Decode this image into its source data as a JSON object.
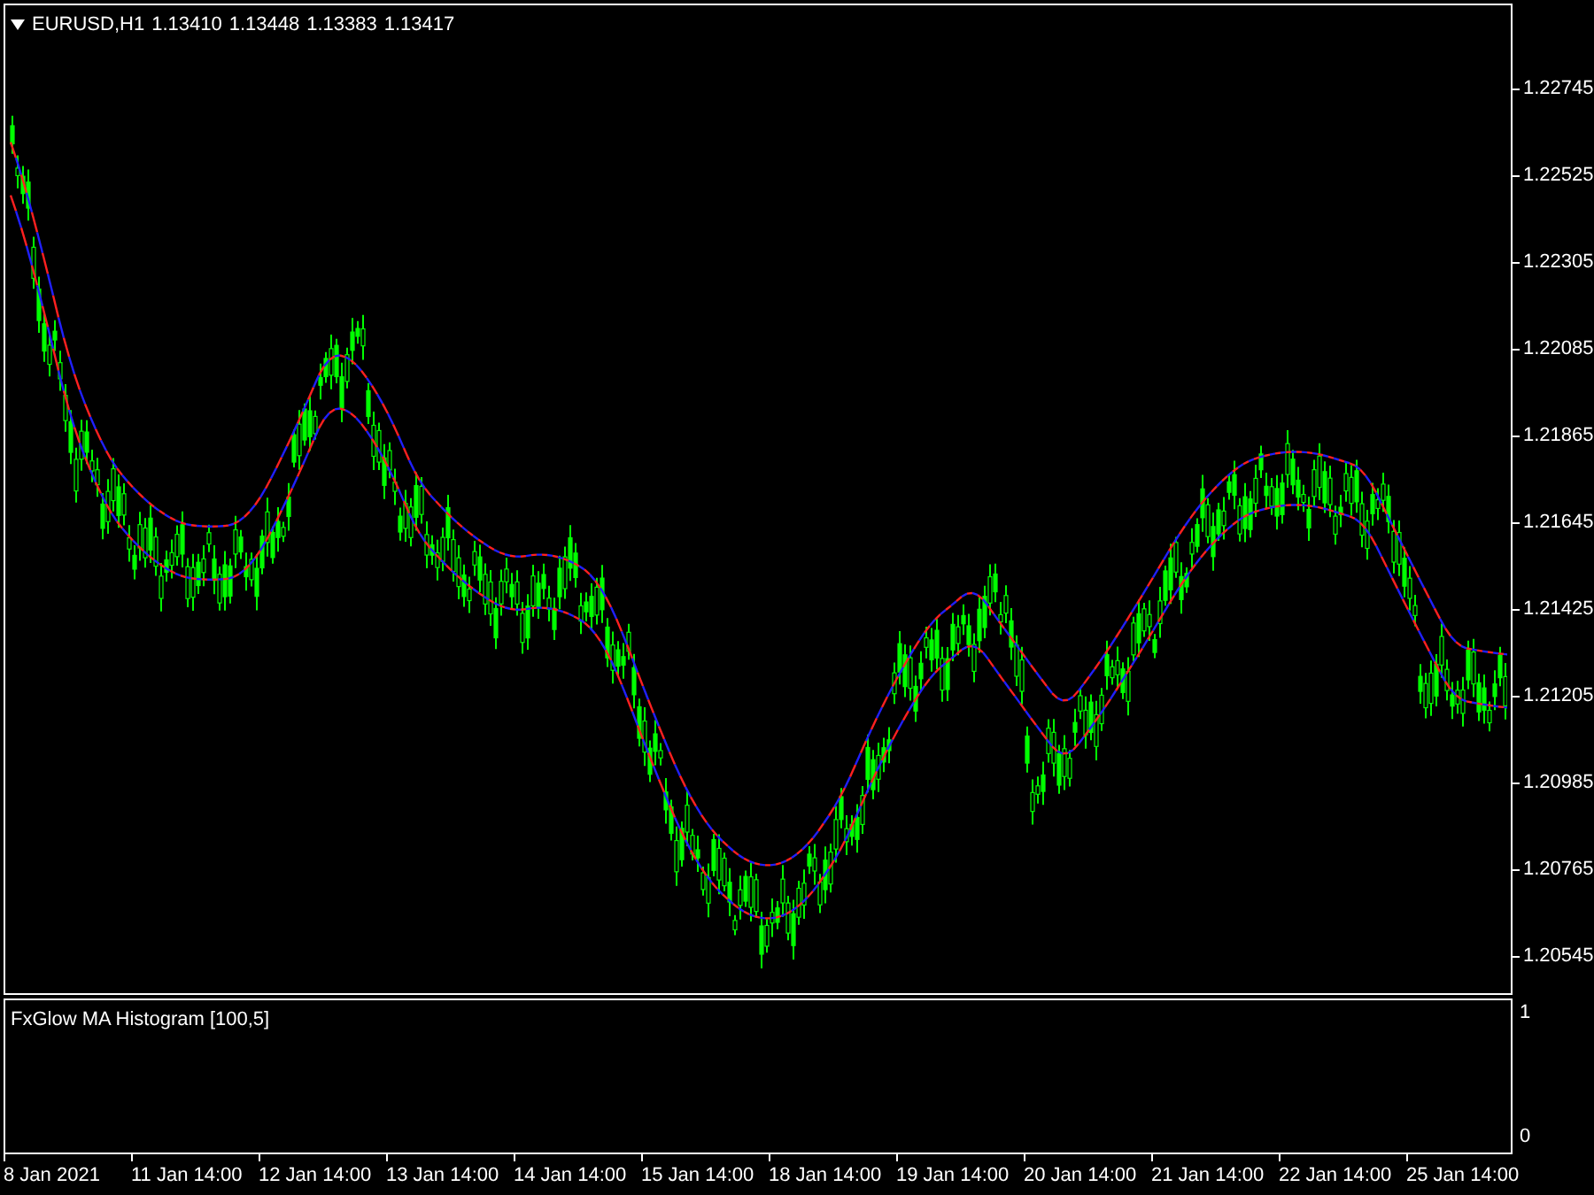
{
  "chart_header": {
    "symbol": "EURUSD,H1",
    "ohlc": [
      "1.13410",
      "1.13448",
      "1.13383",
      "1.13417"
    ]
  },
  "price_axis": [
    "1.22745",
    "1.22525",
    "1.22305",
    "1.22085",
    "1.21865",
    "1.21645",
    "1.21425",
    "1.21205",
    "1.20985",
    "1.20765",
    "1.20545"
  ],
  "indicator_pane": {
    "label": "FxGlow MA Histogram [100,5]",
    "scale": [
      "1",
      "0"
    ]
  },
  "time_axis": [
    "8 Jan 2021",
    "11 Jan 14:00",
    "12 Jan 14:00",
    "13 Jan 14:00",
    "14 Jan 14:00",
    "15 Jan 14:00",
    "18 Jan 14:00",
    "19 Jan 14:00",
    "20 Jan 14:00",
    "21 Jan 14:00",
    "22 Jan 14:00",
    "25 Jan 14:00"
  ]
}
